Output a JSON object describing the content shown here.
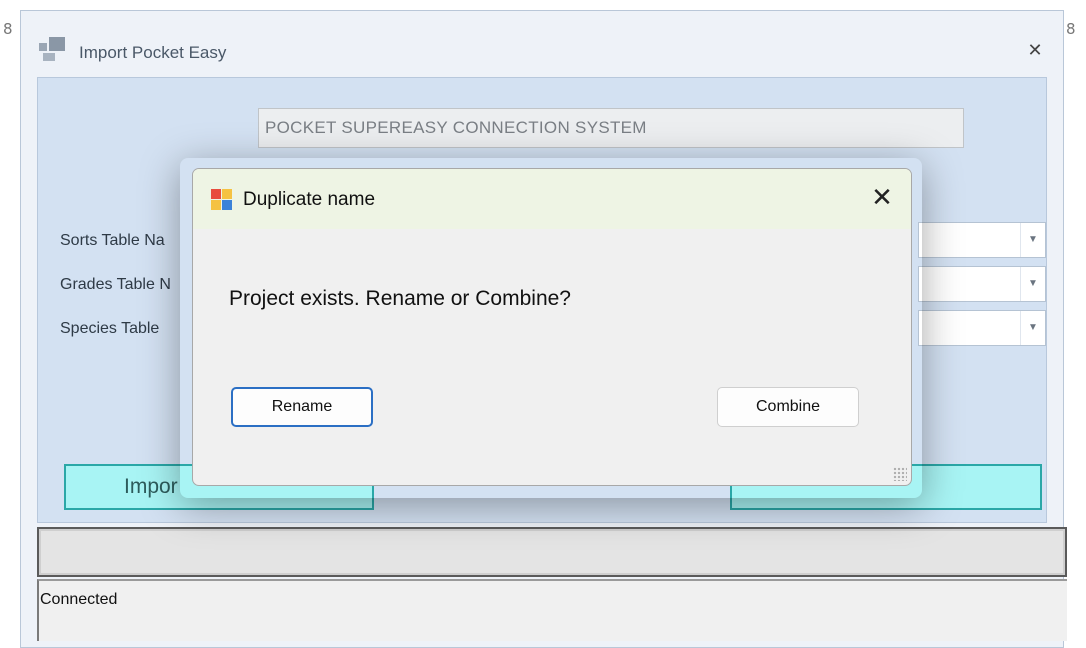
{
  "background": {
    "left_mark": "8",
    "right_mark": "8"
  },
  "main_window": {
    "title": "Import Pocket Easy",
    "close_glyph": "✕",
    "header": "POCKET SUPEREASY CONNECTION SYSTEM",
    "fields": [
      {
        "label": "Sorts Table Na"
      },
      {
        "label": "Grades Table N"
      },
      {
        "label": "Species Table"
      }
    ],
    "buttons": {
      "import_label": "Impor",
      "exit_label": ""
    },
    "status_text": "Connected",
    "colors": {
      "body_bg": "#d3e1f2",
      "button_bg": "#a8f4f4",
      "button_border": "#2aa7a7"
    }
  },
  "dialog": {
    "title": "Duplicate name",
    "close_glyph": "✕",
    "message": "Project exists. Rename or Combine?",
    "rename_label": "Rename",
    "combine_label": "Combine",
    "colors": {
      "titlebar_bg": "#eef4e4",
      "default_button_border": "#2b6fc4"
    }
  }
}
